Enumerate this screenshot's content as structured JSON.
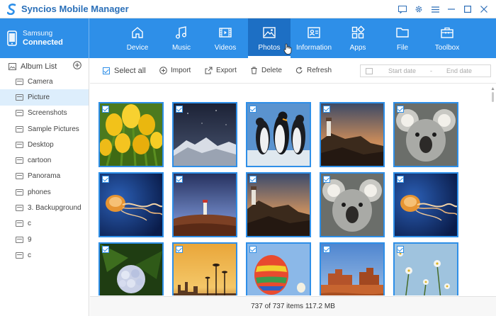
{
  "window": {
    "title": "Syncios Mobile Manager"
  },
  "device": {
    "name": "Samsung",
    "status": "Connected"
  },
  "nav": {
    "tabs": [
      {
        "label": "Device",
        "icon": "home-icon"
      },
      {
        "label": "Music",
        "icon": "music-icon"
      },
      {
        "label": "Videos",
        "icon": "video-icon"
      },
      {
        "label": "Photos",
        "icon": "photo-icon",
        "active": true
      },
      {
        "label": "Information",
        "icon": "contact-icon"
      },
      {
        "label": "Apps",
        "icon": "apps-icon"
      },
      {
        "label": "File",
        "icon": "folder-icon"
      },
      {
        "label": "Toolbox",
        "icon": "toolbox-icon"
      }
    ]
  },
  "sidebar": {
    "header": "Album List",
    "items": [
      {
        "label": "Camera"
      },
      {
        "label": "Picture",
        "selected": true
      },
      {
        "label": "Screenshots"
      },
      {
        "label": "Sample Pictures"
      },
      {
        "label": "Desktop"
      },
      {
        "label": "cartoon"
      },
      {
        "label": "Panorama"
      },
      {
        "label": "phones"
      },
      {
        "label": "3. Backupground"
      },
      {
        "label": "c"
      },
      {
        "label": "9"
      },
      {
        "label": "c"
      }
    ]
  },
  "toolbar": {
    "select_all": "Select all",
    "import": "Import",
    "export": "Export",
    "delete": "Delete",
    "refresh": "Refresh",
    "start_date": "Start date",
    "end_date": "End date"
  },
  "status": {
    "text": "737 of 737 items 117.2 MB"
  },
  "colors": {
    "accent": "#2e8fe8",
    "nav_active": "#1d6fc4",
    "title": "#2a6fb8",
    "selected_row": "#ddeefc"
  }
}
